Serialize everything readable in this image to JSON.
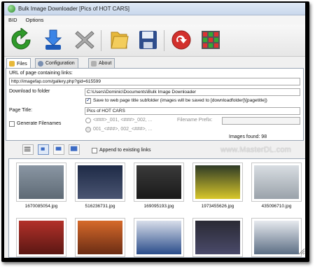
{
  "window": {
    "title": "Bulk Image Downloader [Pics of HOT CARS]"
  },
  "menu": {
    "items": [
      "BID",
      "Options"
    ]
  },
  "toolbar": {
    "buttons": [
      {
        "name": "refresh",
        "icon": "refresh-icon"
      },
      {
        "name": "download",
        "icon": "download-icon"
      },
      {
        "name": "clear",
        "icon": "close-icon"
      },
      {
        "name": "folder",
        "icon": "folder-icon"
      },
      {
        "name": "save",
        "icon": "save-icon"
      },
      {
        "name": "redo",
        "icon": "redo-icon"
      },
      {
        "name": "grid",
        "icon": "grid-icon"
      }
    ]
  },
  "tabs": [
    {
      "label": "Files",
      "active": true
    },
    {
      "label": "Configuration",
      "active": false
    },
    {
      "label": "About",
      "active": false
    }
  ],
  "files": {
    "url_label": "URL of page containing links:",
    "url_value": "http://imagefap.com/gallery.php?gid=615599",
    "download_label": "Download to folder",
    "download_value": "C:\\Users\\Dominic\\Documents\\Bulk Image Downloader",
    "subfolder_checkbox": "Save to web page title subfolder (images will be saved to [downloadfolder]\\[pagetitle])",
    "subfolder_checked": true,
    "page_title_label": "Page Title:",
    "page_title_value": "Pics of HOT CARS",
    "generate_label": "Generate Filenames",
    "generate_checked": false,
    "pattern1": "<###>_001, <###>_002, ...",
    "pattern2": "001_<###>, 002_<###>, ...",
    "prefix_label": "Filename Prefix:",
    "images_found": "Images found: 98"
  },
  "view": {
    "append_label": "Append to existing links"
  },
  "watermark": "www.MasterDL.com",
  "gallery": {
    "items": [
      {
        "name": "1670085054.jpg",
        "color": "#6f7b86"
      },
      {
        "name": "516236731.jpg",
        "color": "#2d3b5c"
      },
      {
        "name": "169095193.jpg",
        "color": "#2a2a2a"
      },
      {
        "name": "1973455626.jpg",
        "color": "#2f3a2a"
      },
      {
        "name": "435096710.jpg",
        "color": "#b3b9bf"
      },
      {
        "name": "",
        "color": "#8a2a22"
      },
      {
        "name": "",
        "color": "#bc5a2a"
      },
      {
        "name": "",
        "color": "#b9c1d4"
      },
      {
        "name": "",
        "color": "#2f2f38"
      },
      {
        "name": "",
        "color": "#6c7c8c"
      }
    ]
  }
}
